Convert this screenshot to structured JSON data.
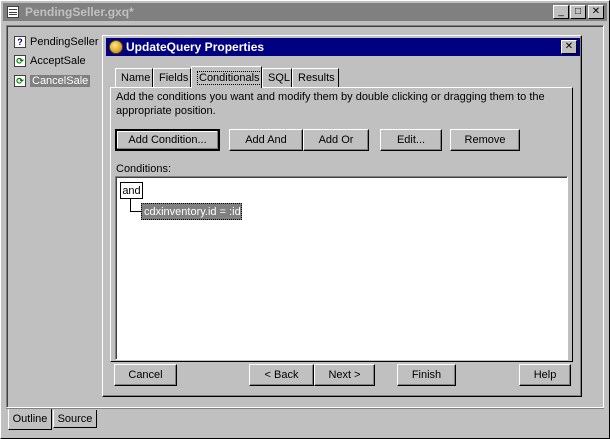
{
  "window": {
    "title": "PendingSeller.gxq*",
    "min_label": "_",
    "max_label": "□",
    "close_label": "✕"
  },
  "outline": {
    "items": [
      {
        "label": "PendingSeller",
        "icon": "query-icon"
      },
      {
        "label": "AcceptSale",
        "icon": "action-icon"
      },
      {
        "label": "CancelSale",
        "icon": "action-icon"
      }
    ]
  },
  "bottom_tabs": [
    {
      "label": "Outline"
    },
    {
      "label": "Source"
    }
  ],
  "dialog": {
    "title": "UpdateQuery Properties",
    "close_label": "✕",
    "tabs": [
      {
        "label": "Name"
      },
      {
        "label": "Fields"
      },
      {
        "label": "Conditionals"
      },
      {
        "label": "SQL"
      },
      {
        "label": "Results"
      }
    ],
    "instructions": "Add the conditions you want and modify them by double clicking or dragging them to the appropriate position.",
    "buttons": {
      "add_condition": "Add Condition...",
      "add_and": "Add And",
      "add_or": "Add Or",
      "edit": "Edit...",
      "remove": "Remove"
    },
    "conditions_label": "Conditions:",
    "tree": {
      "root": "and",
      "child": "cdxinventory.id = :id"
    },
    "footer": {
      "cancel": "Cancel",
      "back": "< Back",
      "next": "Next >",
      "finish": "Finish",
      "help": "Help"
    }
  },
  "colors": {
    "title_active": "#000080",
    "title_inactive": "#808080",
    "face": "#c0c0c0",
    "selection": "#808080"
  }
}
